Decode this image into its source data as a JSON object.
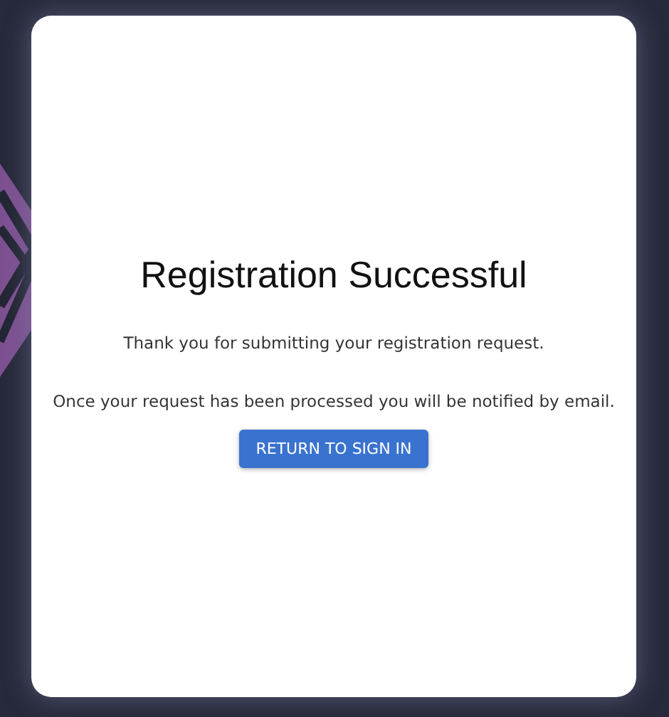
{
  "card": {
    "title": "Registration Successful",
    "messages": [
      "Thank you for submitting your registration request.",
      "Once your request has been processed you will be notified by email."
    ],
    "button": "RETURN TO SIGN IN"
  }
}
